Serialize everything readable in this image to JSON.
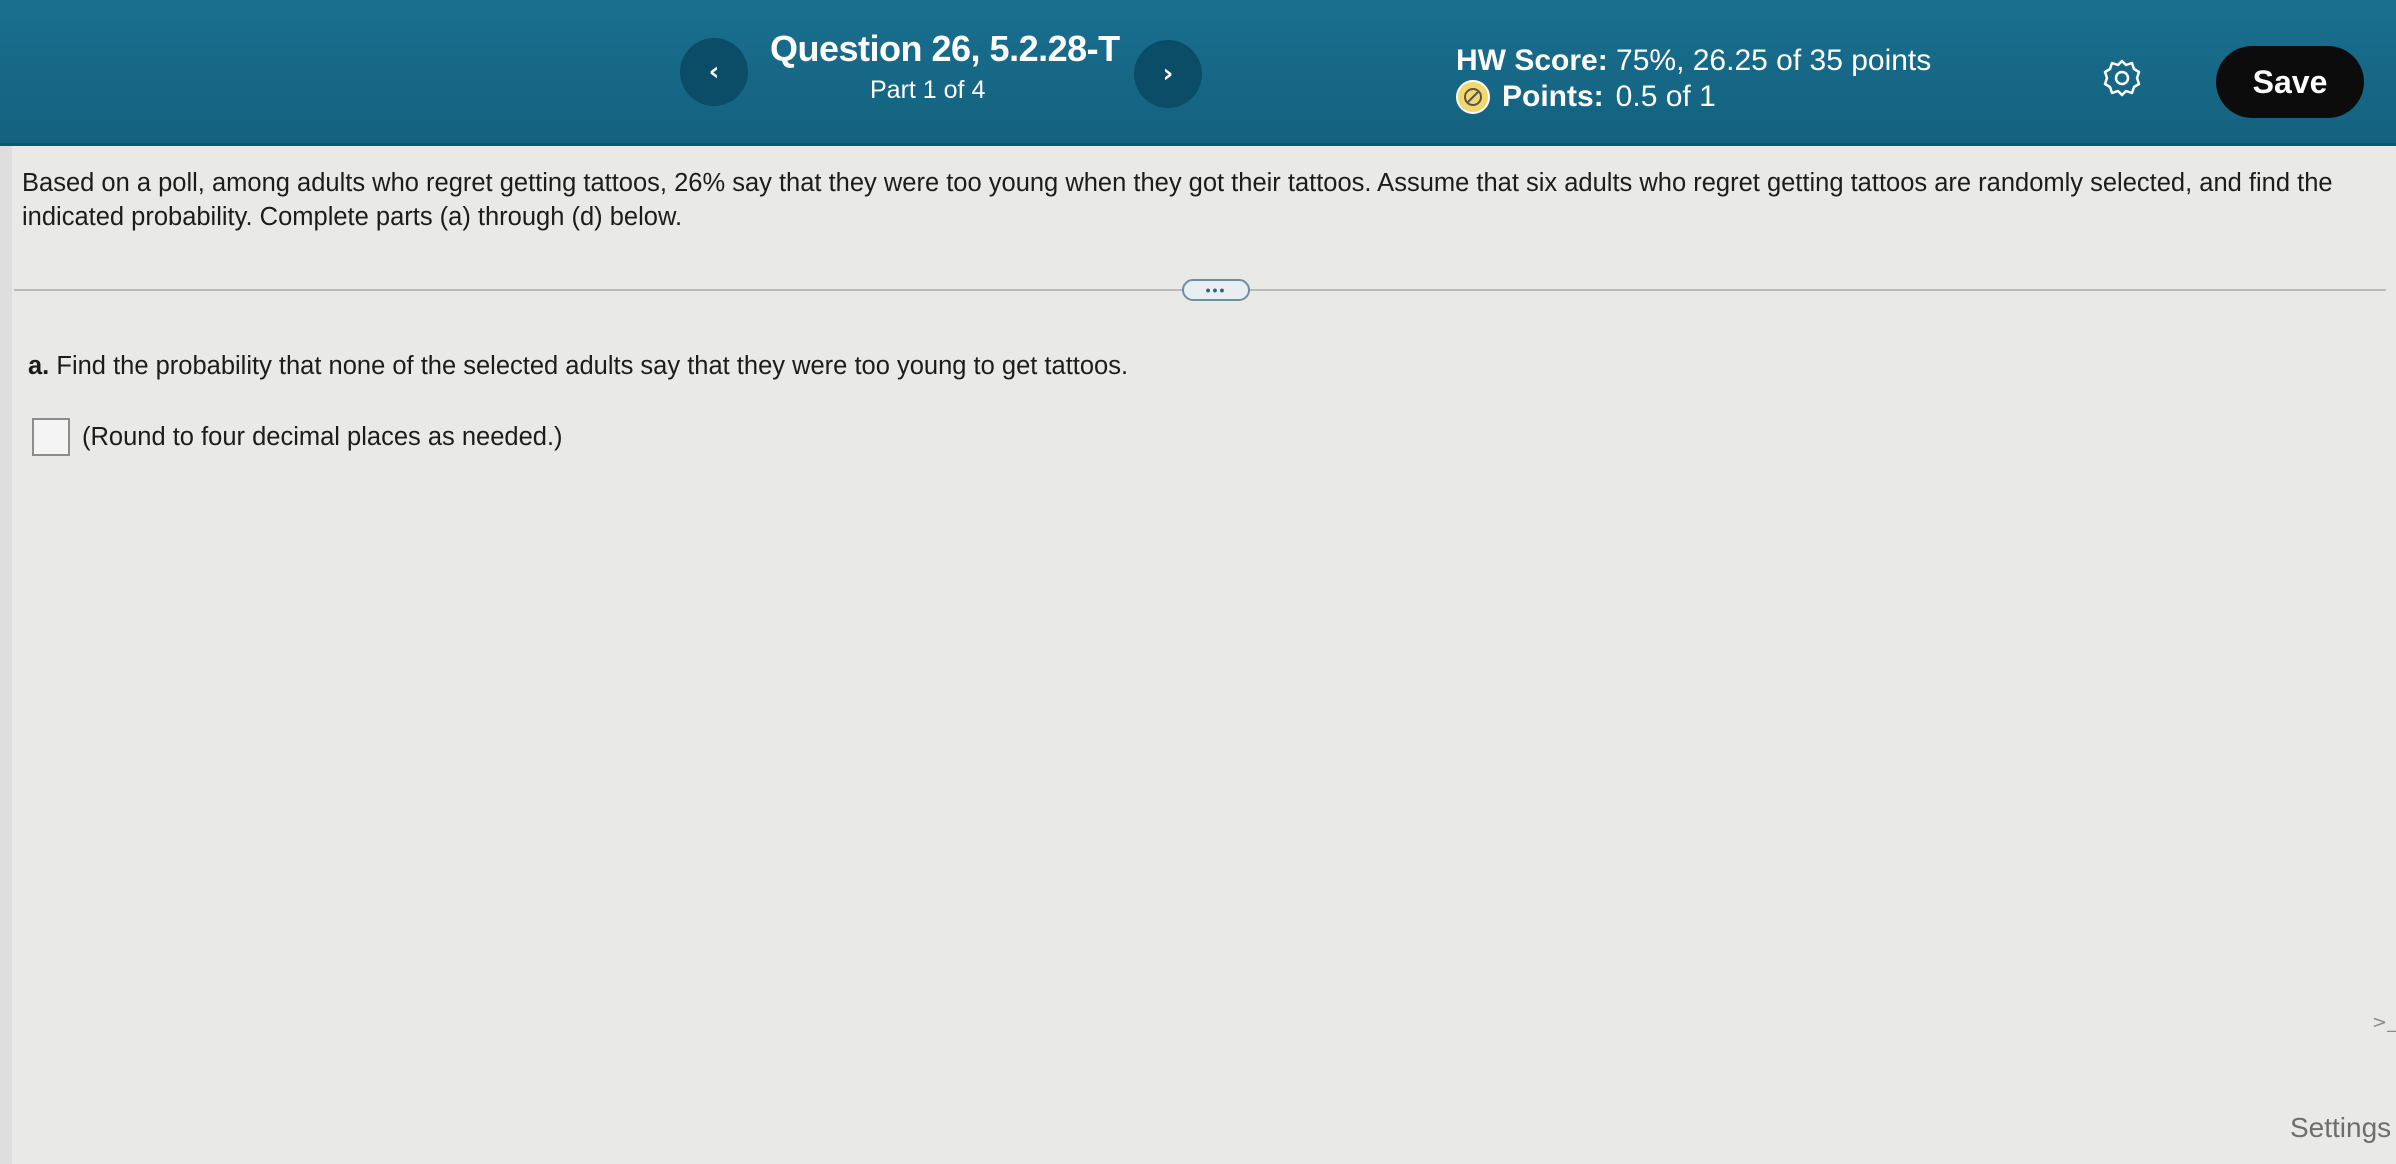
{
  "header": {
    "prev_label": "‹",
    "next_label": "›",
    "question_title": "Question 26, 5.2.28-T",
    "part_label": "Part 1 of 4",
    "hw_score_label": "HW Score:",
    "hw_score_value": "75%, 26.25 of 35 points",
    "points_label": "Points:",
    "points_value": "0.5 of 1",
    "points_icon": "partial-credit-icon",
    "settings_icon": "gear-icon",
    "save_label": "Save",
    "colors": {
      "bar": "#13617f",
      "save": "#0c0c0c",
      "partial": "#f4d76a"
    }
  },
  "problem": {
    "text": "Based on a poll, among adults who regret getting tattoos, 26% say that they were too young when they got their tattoos. Assume that six adults who regret getting tattoos are randomly selected, and find the indicated probability. Complete parts (a) through (d) below."
  },
  "expand_label": "•••",
  "part_a": {
    "letter": "a.",
    "question": "Find the probability that none of the selected adults say that they were too young to get tattoos.",
    "answer_value": "",
    "hint": "(Round to four decimal places as needed.)"
  },
  "footer": {
    "side_chevron": ">_",
    "settings_label": "Settings"
  }
}
